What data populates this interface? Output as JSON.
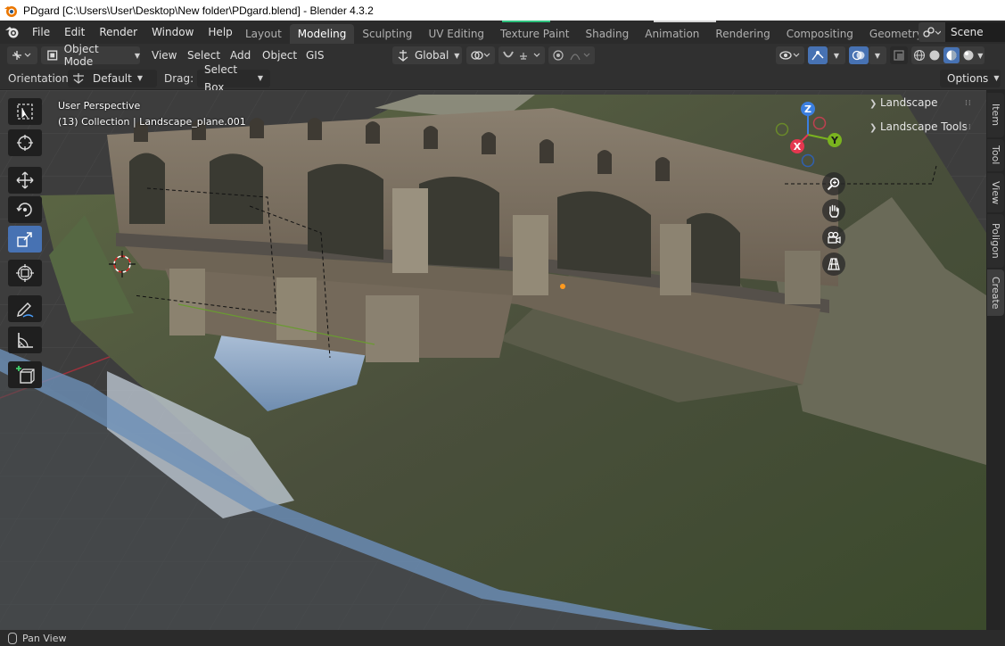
{
  "window": {
    "title": "PDgard [C:\\Users\\User\\Desktop\\New folder\\PDgard.blend] - Blender 4.3.2"
  },
  "topbar": {
    "menus": [
      "File",
      "Edit",
      "Render",
      "Window",
      "Help"
    ],
    "workspaces": [
      {
        "label": "Layout",
        "active": false
      },
      {
        "label": "Modeling",
        "active": true
      },
      {
        "label": "Sculpting",
        "active": false
      },
      {
        "label": "UV Editing",
        "active": false
      },
      {
        "label": "Texture Paint",
        "active": false
      },
      {
        "label": "Shading",
        "active": false
      },
      {
        "label": "Animation",
        "active": false
      },
      {
        "label": "Rendering",
        "active": false
      },
      {
        "label": "Compositing",
        "active": false
      },
      {
        "label": "Geometry Node",
        "active": false
      }
    ],
    "scene_label": "Scene"
  },
  "header": {
    "mode": "Object Mode",
    "menus": [
      "View",
      "Select",
      "Add",
      "Object",
      "GIS"
    ],
    "transform_orientation": "Global"
  },
  "tool_settings": {
    "orientation_label": "Orientation:",
    "orientation_value": "Default",
    "drag_label": "Drag:",
    "drag_value": "Select Box",
    "options_label": "Options"
  },
  "viewport": {
    "perspective": "User Perspective",
    "collection_info": "(13) Collection | Landscape_plane.001"
  },
  "toolbar": {
    "tools": [
      "select-box",
      "cursor",
      "move",
      "rotate",
      "scale",
      "transform",
      "annotate",
      "measure",
      "add-cube"
    ],
    "active_tool": "scale"
  },
  "gizmo": {
    "axes": [
      "Z",
      "Y",
      "X"
    ],
    "colors": {
      "x": "#e5374f",
      "y": "#7ab31f",
      "z": "#3b7fe0"
    }
  },
  "sidebar_panels": [
    {
      "label": "Landscape"
    },
    {
      "label": "Landscape Tools"
    }
  ],
  "sidebar_tabs": [
    {
      "label": "Item",
      "active": false
    },
    {
      "label": "Tool",
      "active": false
    },
    {
      "label": "View",
      "active": false
    },
    {
      "label": "Poligon",
      "active": false
    },
    {
      "label": "Create",
      "active": true
    }
  ],
  "statusbar": {
    "hint": "Pan View"
  }
}
